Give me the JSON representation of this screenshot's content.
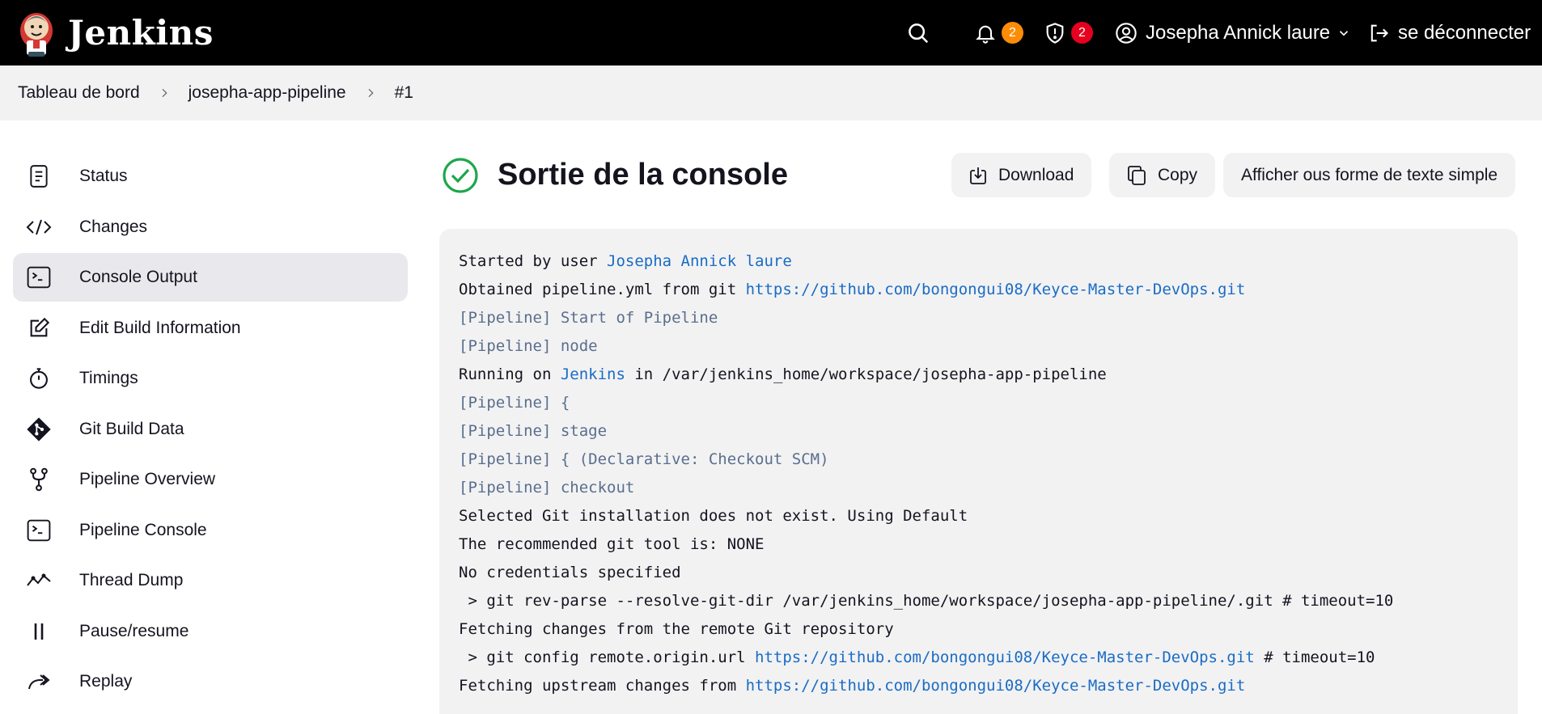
{
  "header": {
    "brand": "Jenkins",
    "notifications_count": "2",
    "security_count": "2",
    "user_name": "Josepha Annick laure",
    "logout_label": "se déconnecter",
    "colors": {
      "background": "#000000",
      "notification_badge": "#fe8c06",
      "security_badge": "#e6001f"
    }
  },
  "breadcrumb": {
    "items": [
      "Tableau de bord",
      "josepha-app-pipeline",
      "#1"
    ]
  },
  "sidebar": {
    "items": [
      {
        "label": "Status",
        "icon": "document-icon"
      },
      {
        "label": "Changes",
        "icon": "code-icon"
      },
      {
        "label": "Console Output",
        "icon": "terminal-icon"
      },
      {
        "label": "Edit Build Information",
        "icon": "edit-icon"
      },
      {
        "label": "Timings",
        "icon": "stopwatch-icon"
      },
      {
        "label": "Git Build Data",
        "icon": "git-icon"
      },
      {
        "label": "Pipeline Overview",
        "icon": "branch-icon"
      },
      {
        "label": "Pipeline Console",
        "icon": "terminal-icon"
      },
      {
        "label": "Thread Dump",
        "icon": "activity-icon"
      },
      {
        "label": "Pause/resume",
        "icon": "pause-icon"
      },
      {
        "label": "Replay",
        "icon": "replay-icon"
      }
    ],
    "active_index": 2
  },
  "main": {
    "title": "Sortie de la console",
    "status_icon": "success-check-icon",
    "buttons": {
      "download": "Download",
      "copy": "Copy",
      "plain_text": "Afficher ous forme de texte simple"
    }
  },
  "console": {
    "lines": [
      {
        "segments": [
          {
            "text": "Started by user "
          },
          {
            "text": "Josepha Annick laure",
            "link": true
          }
        ]
      },
      {
        "segments": [
          {
            "text": "Obtained pipeline.yml from git "
          },
          {
            "text": "https://github.com/bongongui08/Keyce-Master-DevOps.git",
            "link": true
          }
        ]
      },
      {
        "pipeline": true,
        "segments": [
          {
            "text": "[Pipeline] Start of Pipeline"
          }
        ]
      },
      {
        "pipeline": true,
        "segments": [
          {
            "text": "[Pipeline] node"
          }
        ]
      },
      {
        "segments": [
          {
            "text": "Running on "
          },
          {
            "text": "Jenkins",
            "link": true
          },
          {
            "text": " in /var/jenkins_home/workspace/josepha-app-pipeline"
          }
        ]
      },
      {
        "pipeline": true,
        "segments": [
          {
            "text": "[Pipeline] {"
          }
        ]
      },
      {
        "pipeline": true,
        "segments": [
          {
            "text": "[Pipeline] stage"
          }
        ]
      },
      {
        "pipeline": true,
        "segments": [
          {
            "text": "[Pipeline] { (Declarative: Checkout SCM)"
          }
        ]
      },
      {
        "pipeline": true,
        "segments": [
          {
            "text": "[Pipeline] checkout"
          }
        ]
      },
      {
        "segments": [
          {
            "text": "Selected Git installation does not exist. Using Default"
          }
        ]
      },
      {
        "segments": [
          {
            "text": "The recommended git tool is: NONE"
          }
        ]
      },
      {
        "segments": [
          {
            "text": "No credentials specified"
          }
        ]
      },
      {
        "segments": [
          {
            "text": " > git rev-parse --resolve-git-dir /var/jenkins_home/workspace/josepha-app-pipeline/.git # timeout=10"
          }
        ]
      },
      {
        "segments": [
          {
            "text": "Fetching changes from the remote Git repository"
          }
        ]
      },
      {
        "segments": [
          {
            "text": " > git config remote.origin.url "
          },
          {
            "text": "https://github.com/bongongui08/Keyce-Master-DevOps.git",
            "link": true
          },
          {
            "text": " # timeout=10"
          }
        ]
      },
      {
        "segments": [
          {
            "text": "Fetching upstream changes from "
          },
          {
            "text": "https://github.com/bongongui08/Keyce-Master-DevOps.git",
            "link": true
          }
        ]
      }
    ]
  }
}
